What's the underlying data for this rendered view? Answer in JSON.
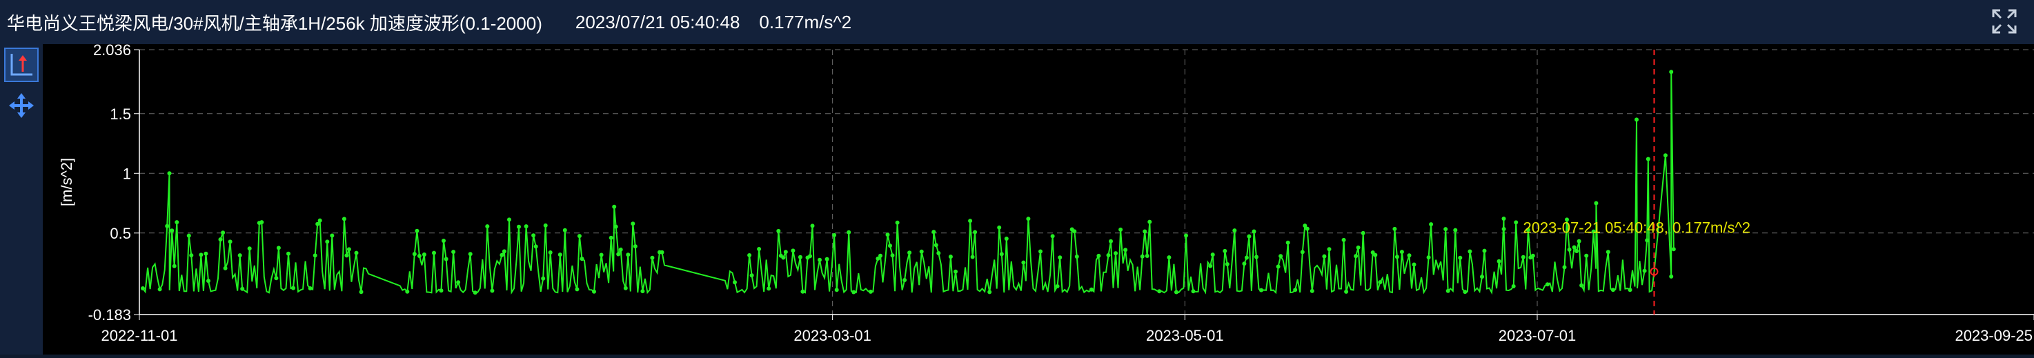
{
  "window": {
    "title": "华电尚义王悦梁风电/30#风机/主轴承1H/256k 加速度波形(0.1-2000)",
    "cursor_time": "2023/07/21 05:40:48",
    "cursor_value": "0.177m/s^2"
  },
  "toolbar": {
    "tools": [
      {
        "name": "axis-cursor-tool",
        "icon": "axis-arrow-icon",
        "active": true
      },
      {
        "name": "pan-tool",
        "icon": "move-arrows-icon",
        "active": false
      }
    ],
    "expand_icon": "expand-arrows-icon"
  },
  "colors": {
    "series": "#22ee22",
    "cursor_line": "#ff2020",
    "annotation": "#e6e600",
    "grid": "#6a6a6a",
    "axis_text": "#ffffff"
  },
  "chart_data": {
    "type": "line",
    "ylabel": "[m/s^2]",
    "y_tick_labels": [
      "2.036",
      "1.5",
      "1",
      "0.5",
      "-0.183"
    ],
    "x_tick_labels": [
      "2022-11-01",
      "2023-03-01",
      "2023-05-01",
      "2023-07-01",
      "2023-09-25"
    ],
    "ylim": [
      -0.183,
      2.036
    ],
    "xlim": [
      "2022-11-01",
      "2023-09-25"
    ],
    "grid": true,
    "cursor": {
      "x": "2023-07-21 05:40:48",
      "y": 0.177,
      "label": "2023-07-21 05:40:48, 0.177m/s^2"
    },
    "baseline": 0.0,
    "band_max_approx": 0.62,
    "spikes": [
      {
        "x": "2022-11-06",
        "y": 1.0
      },
      {
        "x": "2023-01-22",
        "y": 0.72
      },
      {
        "x": "2023-06-25",
        "y": 0.62
      },
      {
        "x": "2023-07-11",
        "y": 0.75
      },
      {
        "x": "2023-07-18",
        "y": 1.45
      },
      {
        "x": "2023-07-20",
        "y": 1.12
      },
      {
        "x": "2023-07-23",
        "y": 1.15
      },
      {
        "x": "2023-07-24",
        "y": 1.85
      }
    ],
    "gaps": [
      {
        "from": "2022-12-11",
        "to": "2022-12-16"
      },
      {
        "from": "2023-01-31",
        "to": "2023-02-10"
      },
      {
        "from": "2023-07-21",
        "to": "2023-07-24"
      }
    ]
  }
}
